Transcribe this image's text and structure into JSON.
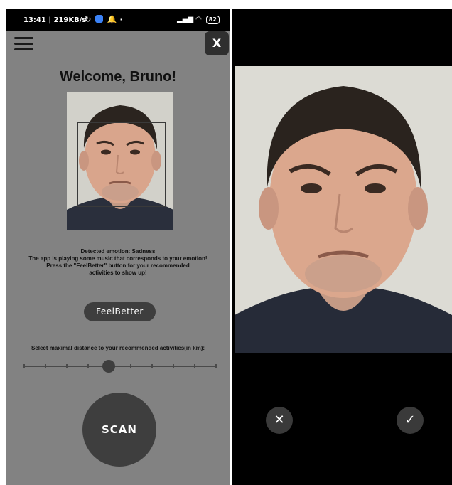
{
  "status_bar": {
    "time_and_speed": "13:41 | 219KB/s",
    "battery": "82"
  },
  "header": {
    "menu_icon": "hamburger-menu-icon",
    "close_label": "X"
  },
  "main": {
    "welcome": "Welcome, Bruno!",
    "emotion_lines": [
      "Detected emotion: Sadness",
      "The app is playing some music that corresponds to your emotion!",
      "Press the \"FeelBetter\" button for your recommended",
      "activities to show up!"
    ],
    "feel_better_label": "FeelBetter",
    "distance_label": "Select maximal distance to your recommended activities(in km):",
    "slider": {
      "ticks": 10,
      "selected_index": 4
    },
    "scan_label": "SCAN"
  },
  "camera_preview": {
    "cancel_icon": "close-icon",
    "confirm_icon": "check-icon"
  },
  "colors": {
    "app_background": "#828282",
    "button_dark": "#3e3e3e",
    "camera_background": "#000000"
  }
}
